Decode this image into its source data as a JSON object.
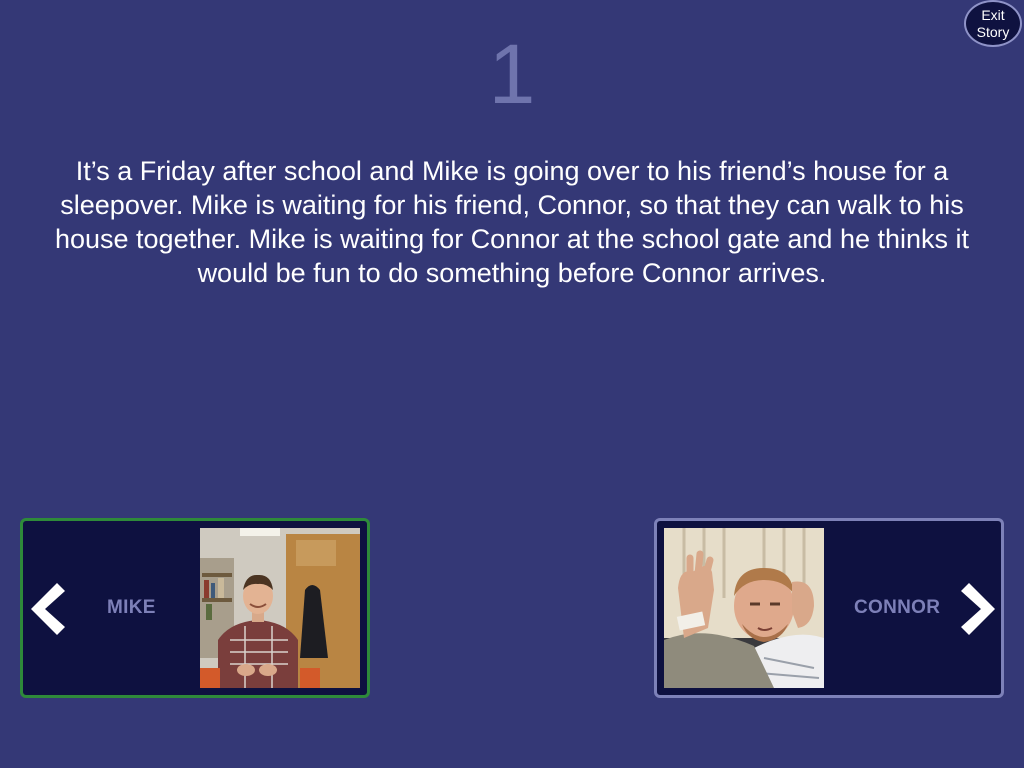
{
  "exit_button": {
    "line1": "Exit",
    "line2": "Story"
  },
  "page_number": "1",
  "story_text": "It’s a Friday after school and Mike is going over to his friend’s house for a sleepover. Mike is waiting for his friend, Connor, so that they can walk to his house together. Mike is waiting for Connor at the school gate and he thinks it would be fun to do something before Connor arrives.",
  "choices": [
    {
      "label": "MIKE",
      "icon": "chevron-left-icon",
      "photo": "mike-photo",
      "selected": true
    },
    {
      "label": "CONNOR",
      "icon": "chevron-right-icon",
      "photo": "connor-photo",
      "selected": false
    }
  ],
  "colors": {
    "background": "#343876",
    "card_background": "#0e1140",
    "selected_border": "#2e8a3a",
    "unselected_border": "#7d81b8",
    "page_number": "#6f74ad",
    "label_text": "#7d80b8"
  }
}
